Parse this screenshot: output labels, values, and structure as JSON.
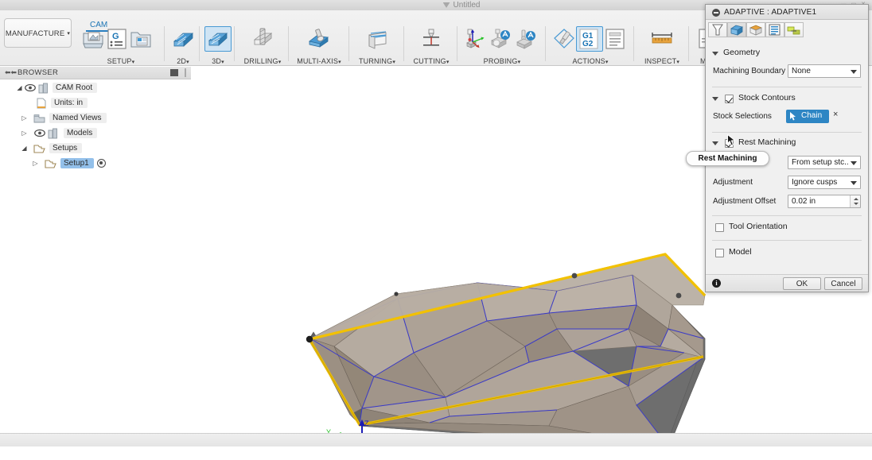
{
  "window": {
    "document_title": "Untitled",
    "doc_icon": "fusion-logo-icon"
  },
  "ribbon": {
    "workspace": "MANUFACTURE",
    "workspace_caret": "▾",
    "tabs": [
      {
        "label": "CAM",
        "active": true
      }
    ],
    "panels": [
      {
        "label": "SETUP",
        "caret": "▾",
        "icons": [
          "new-setup-icon",
          "g-code-folder-icon",
          "new-folder-icon"
        ]
      },
      {
        "label": "2D",
        "caret": "▾",
        "icons": [
          "2d-milling-icon"
        ]
      },
      {
        "label": "3D",
        "caret": "▾",
        "icons": [
          "3d-milling-icon"
        ],
        "selected": true
      },
      {
        "label": "DRILLING",
        "caret": "▾",
        "icons": [
          "drilling-icon"
        ]
      },
      {
        "label": "MULTI-AXIS",
        "caret": "▾",
        "icons": [
          "multi-axis-icon"
        ]
      },
      {
        "label": "TURNING",
        "caret": "▾",
        "icons": [
          "turning-icon"
        ]
      },
      {
        "label": "CUTTING",
        "caret": "▾",
        "icons": [
          "cutting-icon"
        ]
      },
      {
        "label": "PROBING",
        "caret": "▾",
        "icons": [
          "probe-wcs-icon",
          "probe-geometry-icon",
          "probe-tool-icon"
        ]
      },
      {
        "label": "ACTIONS",
        "caret": "▾",
        "icons": [
          "manual-ncs-icon",
          "g1-g2-icon",
          "document-icon"
        ]
      },
      {
        "label": "INSPECT",
        "caret": "▾",
        "icons": [
          "measure-icon"
        ]
      },
      {
        "label": "MA",
        "caret": "",
        "icons": [
          "manage-icon"
        ]
      }
    ]
  },
  "browser": {
    "title": "BROWSER",
    "collapse_icon": "double-left-arrow-icon",
    "menu_icon": "panel-menu-icon",
    "items": [
      {
        "label": "CAM Root",
        "indent": 0,
        "expander": "◢",
        "eye": true,
        "icon": "cam-root-icon",
        "selected": false,
        "dot": false
      },
      {
        "label": "Units: in",
        "indent": 1,
        "expander": "",
        "eye": false,
        "icon": "units-doc-icon",
        "selected": false,
        "dot": false
      },
      {
        "label": "Named Views",
        "indent": 1,
        "expander": "▷",
        "eye": false,
        "icon": "views-folder-icon",
        "selected": false,
        "dot": false
      },
      {
        "label": "Models",
        "indent": 1,
        "expander": "▷",
        "eye": true,
        "icon": "models-icon",
        "selected": false,
        "dot": false
      },
      {
        "label": "Setups",
        "indent": 1,
        "expander": "◢",
        "eye": false,
        "icon": "open-folder-icon",
        "selected": false,
        "dot": false
      },
      {
        "label": "Setup1",
        "indent": 2,
        "expander": "▷",
        "eye": false,
        "icon": "setup-folder-icon",
        "selected": true,
        "dot": true
      }
    ]
  },
  "dialog": {
    "title": "ADAPTIVE : ADAPTIVE1",
    "close_icon": "collapse-dialog-icon",
    "tabs": [
      {
        "name": "tool-tab",
        "icon": "tool-cone-icon",
        "active": false
      },
      {
        "name": "geometry-tab",
        "icon": "geometry-solid-icon",
        "active": true
      },
      {
        "name": "heights-tab",
        "icon": "heights-box-icon",
        "active": false
      },
      {
        "name": "passes-tab",
        "icon": "passes-list-icon",
        "active": false
      },
      {
        "name": "linking-tab",
        "icon": "linking-icon",
        "active": false
      }
    ],
    "sections": [
      {
        "name": "geometry",
        "label": "Geometry",
        "expanded": true,
        "has_checkbox": false
      },
      {
        "name": "stock-contours",
        "label": "Stock Contours",
        "expanded": true,
        "has_checkbox": true,
        "checked": true
      },
      {
        "name": "rest-machining",
        "label": "Rest Machining",
        "expanded": true,
        "has_checkbox": true,
        "checked": true
      },
      {
        "name": "tool-orientation",
        "label": "Tool Orientation",
        "expanded": false,
        "has_checkbox": true,
        "checked": false
      },
      {
        "name": "model",
        "label": "Model",
        "expanded": false,
        "has_checkbox": true,
        "checked": false
      }
    ],
    "fields": {
      "machining_boundary_label": "Machining Boundary",
      "machining_boundary_value": "None",
      "stock_selections_label": "Stock Selections",
      "stock_selections_button": "Chain",
      "stock_selections_clear": "×",
      "source_value": "From setup stc...",
      "adjustment_label": "Adjustment",
      "adjustment_value": "Ignore cusps",
      "adjustment_offset_label": "Adjustment Offset",
      "adjustment_offset_value": "0.02 in"
    },
    "footer": {
      "info_icon": "info-icon",
      "info_glyph": "i",
      "ok": "OK",
      "cancel": "Cancel"
    }
  },
  "tooltip": {
    "text": "Rest Machining"
  },
  "viewport": {
    "triad": {
      "x_label": "X",
      "y_label": "Y",
      "z_label": "Z",
      "x_color": "#b50d1c",
      "y_color": "#25c225",
      "z_color": "#1b1bb5"
    },
    "model": {
      "selected_edge_color": "#f2c100",
      "face_color_light": "#b7ada1",
      "face_color_mid": "#a09487",
      "face_color_dark": "#8c8075",
      "side_wall_color": "#6e6e6e",
      "interior_edge_color": "#3b3bc8",
      "vertex_color": "#1e1e1e"
    }
  }
}
